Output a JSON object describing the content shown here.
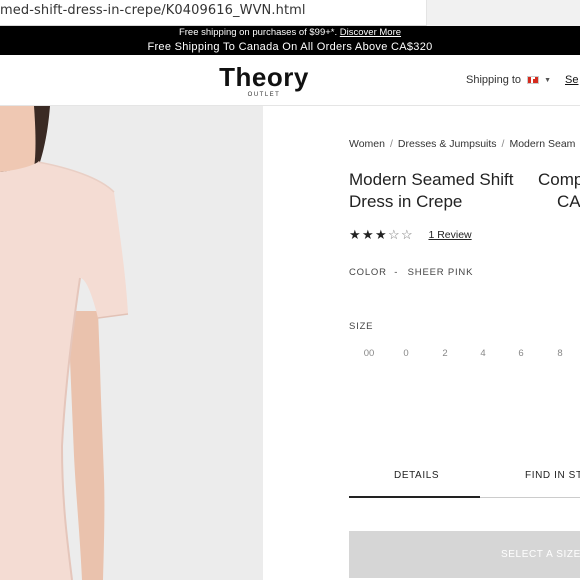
{
  "browser": {
    "url": "med-shift-dress-in-crepe/K0409616_WVN.html"
  },
  "promo": {
    "line1_text": "Free shipping on purchases of $99+*.",
    "line1_link": "Discover More",
    "line2_text": "Free Shipping To Canada On All Orders Above CA$320"
  },
  "header": {
    "brand": "Theory",
    "brand_sub": "OUTLET",
    "shipping_label": "Shipping to",
    "shipping_flag": "canada-flag-icon",
    "search_label": "Se"
  },
  "breadcrumb": {
    "items": [
      "Women",
      "Dresses & Jumpsuits",
      "Modern Seam"
    ],
    "separator": "/"
  },
  "product": {
    "title": "Modern Seamed Shift Dress in Crepe",
    "compare_label": "Comp",
    "compare_price": "CA",
    "rating": 3,
    "rating_max": 5,
    "review_link": "1 Review",
    "color_label": "COLOR",
    "color_separator": "-",
    "color_value": "SHEER PINK",
    "size_label": "SIZE",
    "sizes": [
      "00",
      "0",
      "2",
      "4",
      "6",
      "8"
    ]
  },
  "tabs": {
    "details": "DETAILS",
    "find_in_store": "FIND IN STO"
  },
  "cta": {
    "select_size": "SELECT A SIZE"
  },
  "colors": {
    "promo_bg": "#000000",
    "dress": "#f4dcd3",
    "image_bg": "#ececec",
    "button_disabled": "#d6d6d6"
  }
}
